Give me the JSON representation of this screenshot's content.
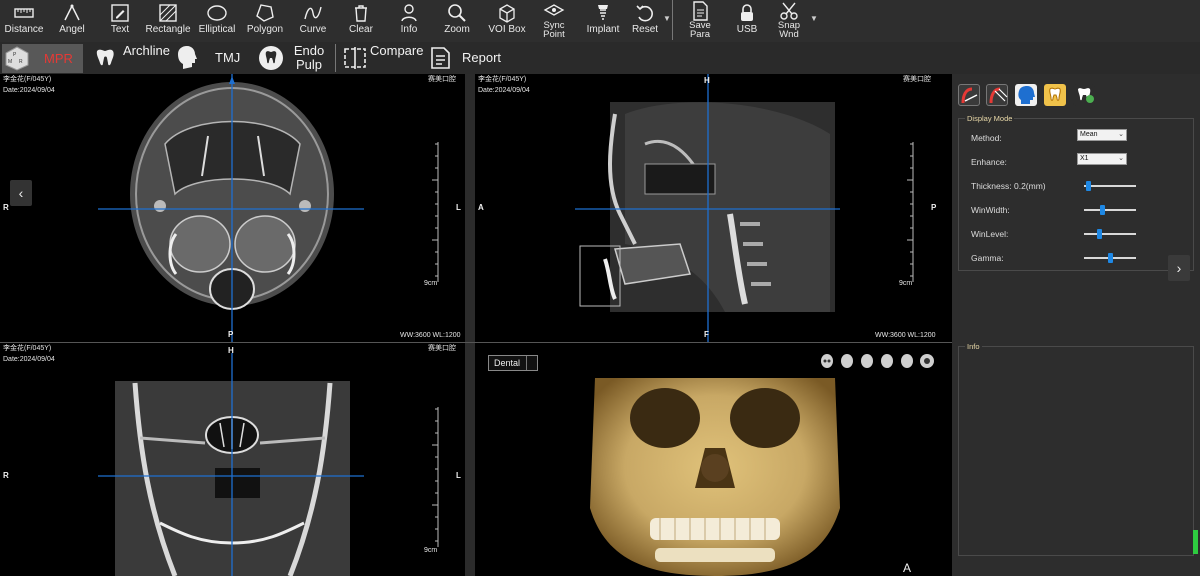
{
  "toolbar": {
    "tools": [
      {
        "label": "Distance",
        "icon": "ruler-icon"
      },
      {
        "label": "Angel",
        "icon": "angle-icon"
      },
      {
        "label": "Text",
        "icon": "text-pencil-icon"
      },
      {
        "label": "Rectangle",
        "icon": "rectangle-icon"
      },
      {
        "label": "Elliptical",
        "icon": "ellipse-icon"
      },
      {
        "label": "Polygon",
        "icon": "polygon-icon"
      },
      {
        "label": "Curve",
        "icon": "curve-icon"
      },
      {
        "label": "Clear",
        "icon": "trash-icon"
      },
      {
        "label": "Info",
        "icon": "person-info-icon"
      },
      {
        "label": "Zoom",
        "icon": "zoom-icon"
      },
      {
        "label": "VOI Box",
        "icon": "cube-icon"
      },
      {
        "label": "Sync Point",
        "icon": "sync-point-icon"
      },
      {
        "label": "Implant",
        "icon": "implant-icon"
      },
      {
        "label": "Reset",
        "icon": "reset-icon"
      },
      {
        "label": "Save Para",
        "icon": "save-document-icon"
      },
      {
        "label": "USB",
        "icon": "usb-lock-icon"
      },
      {
        "label": "Snap Wnd",
        "icon": "scissors-icon"
      }
    ]
  },
  "modes": {
    "mpr": "MPR",
    "archline": "Archline",
    "tmj": "TMJ",
    "endo": "Endo Pulp",
    "compare": "Compare",
    "report": "Report"
  },
  "patient": {
    "name": "李金花(F/045Y)",
    "date": "Date:2024/09/04",
    "clinic": "赛美口腔"
  },
  "views": {
    "axial": {
      "top": "",
      "bottom": "P",
      "left": "R",
      "right": "L",
      "scale": "9cm",
      "wwwl": "WW:3600 WL:1200"
    },
    "sagittal": {
      "top": "H",
      "bottom": "F",
      "left": "A",
      "right": "P",
      "scale": "9cm",
      "wwwl": "WW:3600 WL:1200"
    },
    "coronal": {
      "top": "H",
      "left": "R",
      "right": "L",
      "scale": "9cm"
    },
    "volume": {
      "preset": "Dental",
      "bottom": "A"
    }
  },
  "display_mode": {
    "title": "Display Mode",
    "method_label": "Method:",
    "method_value": "Mean",
    "enhance_label": "Enhance:",
    "enhance_value": "X1",
    "thickness_label": "Thickness: 0.2(mm)",
    "thickness_level": 0.04,
    "winwidth_label": "WinWidth:",
    "winwidth_level": 0.35,
    "winlevel_label": "WinLevel:",
    "winlevel_level": 0.27,
    "gamma_label": "Gamma:",
    "gamma_level": 0.5
  },
  "info_panel": {
    "title": "Info"
  },
  "nav": {
    "left": "‹",
    "right": "›"
  },
  "colors": {
    "crosshair": "#1e6fd0",
    "accent_red": "#e53935",
    "slider_knob": "#1e88e5",
    "bone": "#c8a865"
  }
}
